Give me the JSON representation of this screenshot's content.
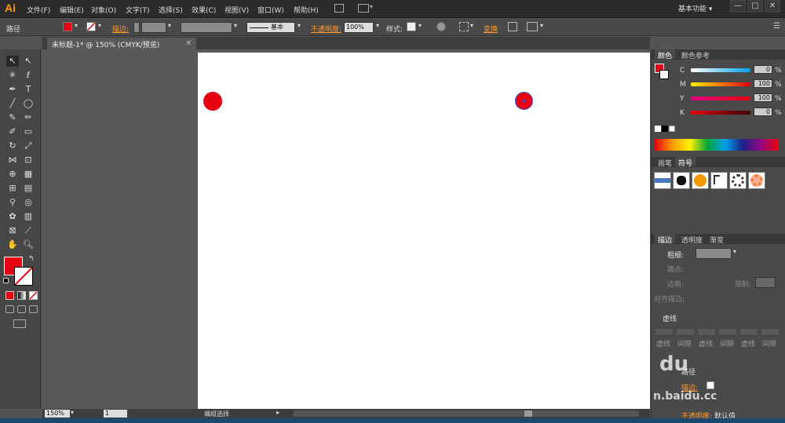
{
  "app": {
    "logo": "Ai"
  },
  "menu": [
    "文件(F)",
    "编辑(E)",
    "对象(O)",
    "文字(T)",
    "选择(S)",
    "效果(C)",
    "视图(V)",
    "窗口(W)",
    "帮助(H)"
  ],
  "workspace": "基本功能",
  "window_buttons": {
    "minimize": "—",
    "maximize": "□",
    "close": "✕"
  },
  "control": {
    "selection_label": "路径",
    "stroke_label": "描边:",
    "stroke_profile": "基本",
    "opacity_label": "不透明度:",
    "opacity_value": "100%",
    "style_label": "样式:",
    "transform_label": "变换"
  },
  "document": {
    "tab_title": "未标题-1* @ 150% (CMYK/预览)"
  },
  "colors": {
    "fill": "#e60012",
    "accent_orange": "#ff9a2e"
  },
  "color_panel": {
    "tabs": [
      "颜色",
      "颜色参考"
    ],
    "rows": [
      {
        "label": "C",
        "value": "0",
        "unit": "%"
      },
      {
        "label": "M",
        "value": "100",
        "unit": "%"
      },
      {
        "label": "Y",
        "value": "100",
        "unit": "%"
      },
      {
        "label": "K",
        "value": "0",
        "unit": "%"
      }
    ]
  },
  "symbols_panel": {
    "tabs": [
      "画笔",
      "符号"
    ]
  },
  "stroke_panel": {
    "tabs": [
      "描边",
      "透明度",
      "渐变"
    ],
    "weight_label": "粗细:",
    "cap_label": "端点:",
    "corner_label": "边角:",
    "limit_label": "限制:",
    "align_label": "对齐描边:",
    "dashed_label": "虚线",
    "dash_labels": [
      "虚线",
      "间隙",
      "虚线",
      "间隙",
      "虚线",
      "间隙"
    ]
  },
  "appearance_panel": {
    "item": "路径",
    "stroke_label": "描边:",
    "opacity_label": "不透明度:",
    "opacity_value": "默认值"
  },
  "status": {
    "zoom": "150%",
    "page": "1",
    "tool_status": "编组选择"
  },
  "watermark": "du",
  "watermark_site": "n.baidu.cc"
}
